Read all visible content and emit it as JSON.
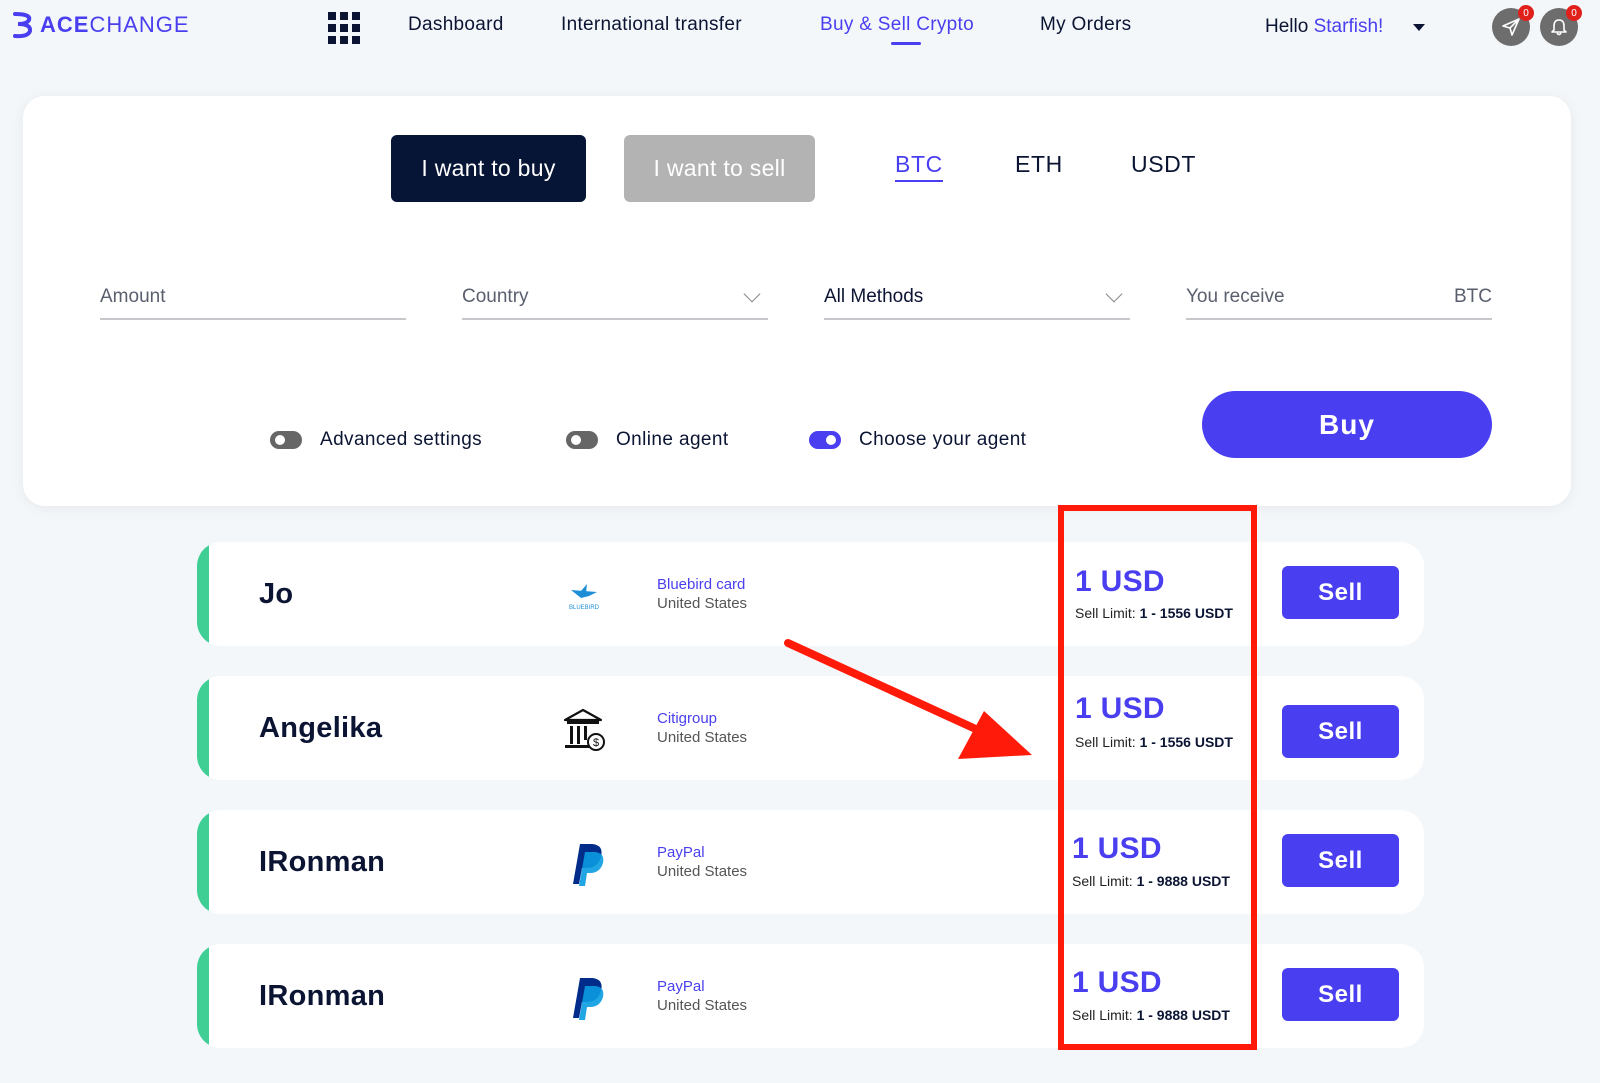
{
  "brand": {
    "name_bold": "ACE",
    "name_regular": "CHANGE",
    "accent": "#4a3ff0"
  },
  "nav": {
    "links": [
      {
        "label": "Dashboard"
      },
      {
        "label": "International transfer"
      },
      {
        "label": "Buy & Sell Crypto",
        "active": true
      },
      {
        "label": "My Orders"
      }
    ],
    "greeting": "Hello",
    "user_name": "Starfish!",
    "messages_count": "0",
    "notifications_count": "0"
  },
  "trade": {
    "buy_label": "I want to buy",
    "sell_label": "I want to sell",
    "coins": [
      "BTC",
      "ETH",
      "USDT"
    ],
    "active_coin": "BTC",
    "amount_placeholder": "Amount",
    "country_placeholder": "Country",
    "method_value": "All Methods",
    "receive_placeholder": "You receive",
    "receive_unit": "BTC",
    "toggles": [
      {
        "label": "Advanced settings",
        "on": false
      },
      {
        "label": "Online agent",
        "on": false
      },
      {
        "label": "Choose your agent",
        "on": true
      }
    ],
    "buy_button": "Buy"
  },
  "offers": [
    {
      "agent": "Jo",
      "method": "Bluebird card",
      "method_icon": "bluebird-logo-icon",
      "icon_text": "BLUEBIRD",
      "country": "United States",
      "price": "1 USD",
      "limit_label": "Sell Limit:",
      "limit_value": "1 - 1556 USDT",
      "action": "Sell"
    },
    {
      "agent": "Angelika",
      "method": "Citigroup",
      "method_icon": "bank-icon",
      "country": "United States",
      "price": "1 USD",
      "limit_label": "Sell Limit:",
      "limit_value": "1 - 1556 USDT",
      "action": "Sell"
    },
    {
      "agent": "IRonman",
      "method": "PayPal",
      "method_icon": "paypal-icon",
      "country": "United States",
      "price": "1 USD",
      "limit_label": "Sell Limit:",
      "limit_value": "1 - 9888 USDT",
      "action": "Sell"
    },
    {
      "agent": "IRonman",
      "method": "PayPal",
      "method_icon": "paypal-icon",
      "country": "United States",
      "price": "1 USD",
      "limit_label": "Sell Limit:",
      "limit_value": "1 - 9888 USDT",
      "action": "Sell"
    }
  ],
  "colors": {
    "accent": "#4a3ff0",
    "dark": "#061436",
    "green": "#3fcf95",
    "annotation": "#ff1a0a"
  }
}
